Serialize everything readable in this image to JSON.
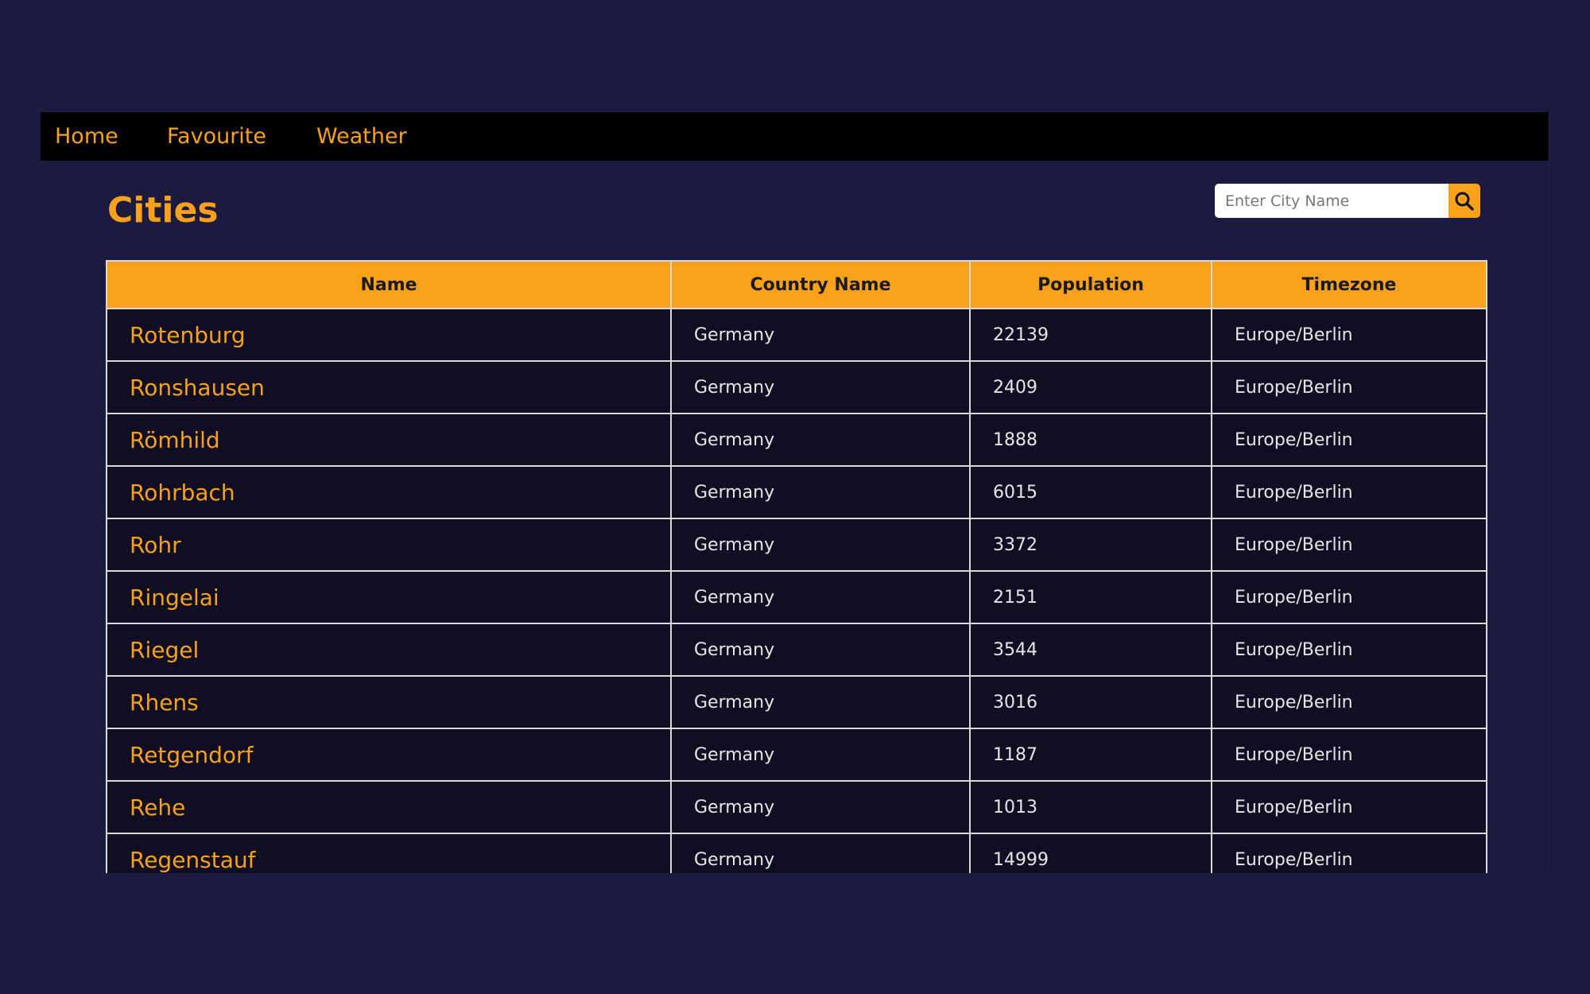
{
  "nav": {
    "home": "Home",
    "favourite": "Favourite",
    "weather": "Weather"
  },
  "page": {
    "title": "Cities"
  },
  "search": {
    "placeholder": "Enter City Name",
    "icon": "search-icon"
  },
  "table": {
    "headers": [
      "Name",
      "Country Name",
      "Population",
      "Timezone"
    ],
    "rows": [
      {
        "name": "Rotenburg",
        "country": "Germany",
        "population": "22139",
        "timezone": "Europe/Berlin"
      },
      {
        "name": "Ronshausen",
        "country": "Germany",
        "population": "2409",
        "timezone": "Europe/Berlin"
      },
      {
        "name": "Römhild",
        "country": "Germany",
        "population": "1888",
        "timezone": "Europe/Berlin"
      },
      {
        "name": "Rohrbach",
        "country": "Germany",
        "population": "6015",
        "timezone": "Europe/Berlin"
      },
      {
        "name": "Rohr",
        "country": "Germany",
        "population": "3372",
        "timezone": "Europe/Berlin"
      },
      {
        "name": "Ringelai",
        "country": "Germany",
        "population": "2151",
        "timezone": "Europe/Berlin"
      },
      {
        "name": "Riegel",
        "country": "Germany",
        "population": "3544",
        "timezone": "Europe/Berlin"
      },
      {
        "name": "Rhens",
        "country": "Germany",
        "population": "3016",
        "timezone": "Europe/Berlin"
      },
      {
        "name": "Retgendorf",
        "country": "Germany",
        "population": "1187",
        "timezone": "Europe/Berlin"
      },
      {
        "name": "Rehe",
        "country": "Germany",
        "population": "1013",
        "timezone": "Europe/Berlin"
      },
      {
        "name": "Regenstauf",
        "country": "Germany",
        "population": "14999",
        "timezone": "Europe/Berlin"
      }
    ]
  },
  "colors": {
    "background": "#1c1b3f",
    "accent": "#f9a11b",
    "navbar": "#000000",
    "row_background": "#0f0e22",
    "border": "#d9d9d9"
  }
}
